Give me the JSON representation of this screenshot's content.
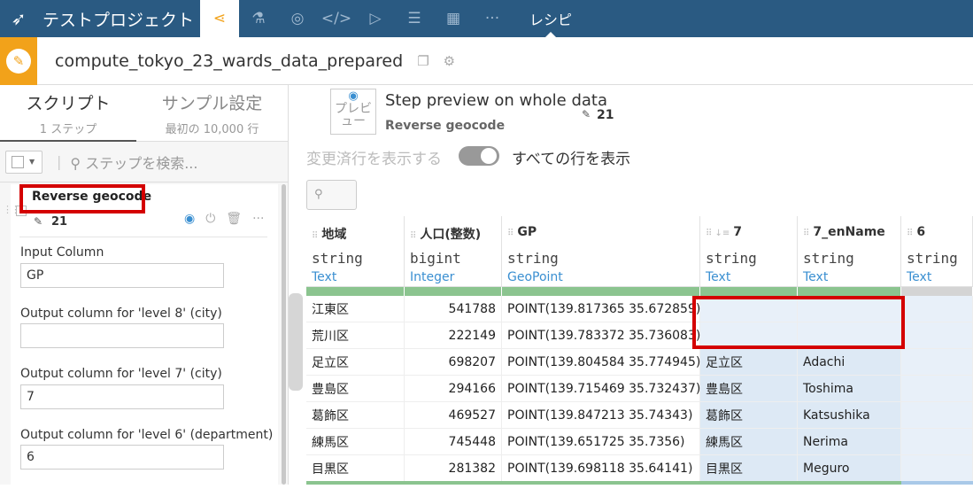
{
  "project_title": "テストプロジェクト",
  "nav": {
    "recipe_label": "レシピ",
    "icons": [
      "flow-icon",
      "lab-icon",
      "deploy-icon",
      "code-icon",
      "run-icon",
      "notebook-icon",
      "dashboard-icon",
      "more-icon"
    ]
  },
  "header": {
    "recipe_name": "compute_tokyo_23_wards_data_prepared"
  },
  "left": {
    "tab_script": "スクリプト",
    "tab_script_sub": "1 ステップ",
    "tab_sample": "サンプル設定",
    "tab_sample_sub": "最初の 10,000 行",
    "search_placeholder": "ステップを検索...",
    "step": {
      "title": "Reverse geocode",
      "count": "21",
      "fields": [
        {
          "label": "Input Column",
          "value": "GP"
        },
        {
          "label": "Output column for 'level 8' (city)",
          "value": ""
        },
        {
          "label": "Output column for 'level 7' (city)",
          "value": "7"
        },
        {
          "label": "Output column for 'level 6' (department)",
          "value": "6"
        }
      ]
    }
  },
  "preview": {
    "doc_text": "プレビュー",
    "title": "Step preview on whole data",
    "subtitle": "Reverse geocode",
    "count": "21",
    "changed_rows_label": "変更済行を表示する",
    "all_rows_label": "すべての行を表示"
  },
  "table": {
    "columns": [
      {
        "name": "地域",
        "storage": "string",
        "meaning": "Text"
      },
      {
        "name": "人口(整数)",
        "storage": "bigint",
        "meaning": "Integer"
      },
      {
        "name": "GP",
        "storage": "string",
        "meaning": "GeoPoint"
      },
      {
        "name": "7",
        "storage": "string",
        "meaning": "Text"
      },
      {
        "name": "7_enName",
        "storage": "string",
        "meaning": "Text"
      },
      {
        "name": "6",
        "storage": "string",
        "meaning": "Text"
      }
    ],
    "rows": [
      [
        "江東区",
        "541788",
        "POINT(139.817365 35.672859)",
        "",
        "",
        ""
      ],
      [
        "荒川区",
        "222149",
        "POINT(139.783372 35.736083)",
        "",
        "",
        ""
      ],
      [
        "足立区",
        "698207",
        "POINT(139.804584 35.774945)",
        "足立区",
        "Adachi",
        ""
      ],
      [
        "豊島区",
        "294166",
        "POINT(139.715469 35.732437)",
        "豊島区",
        "Toshima",
        ""
      ],
      [
        "葛飾区",
        "469527",
        "POINT(139.847213 35.74343)",
        "葛飾区",
        "Katsushika",
        ""
      ],
      [
        "練馬区",
        "745448",
        "POINT(139.651725 35.7356)",
        "練馬区",
        "Nerima",
        ""
      ],
      [
        "目黒区",
        "281382",
        "POINT(139.698118 35.64141)",
        "目黒区",
        "Meguro",
        ""
      ]
    ]
  }
}
